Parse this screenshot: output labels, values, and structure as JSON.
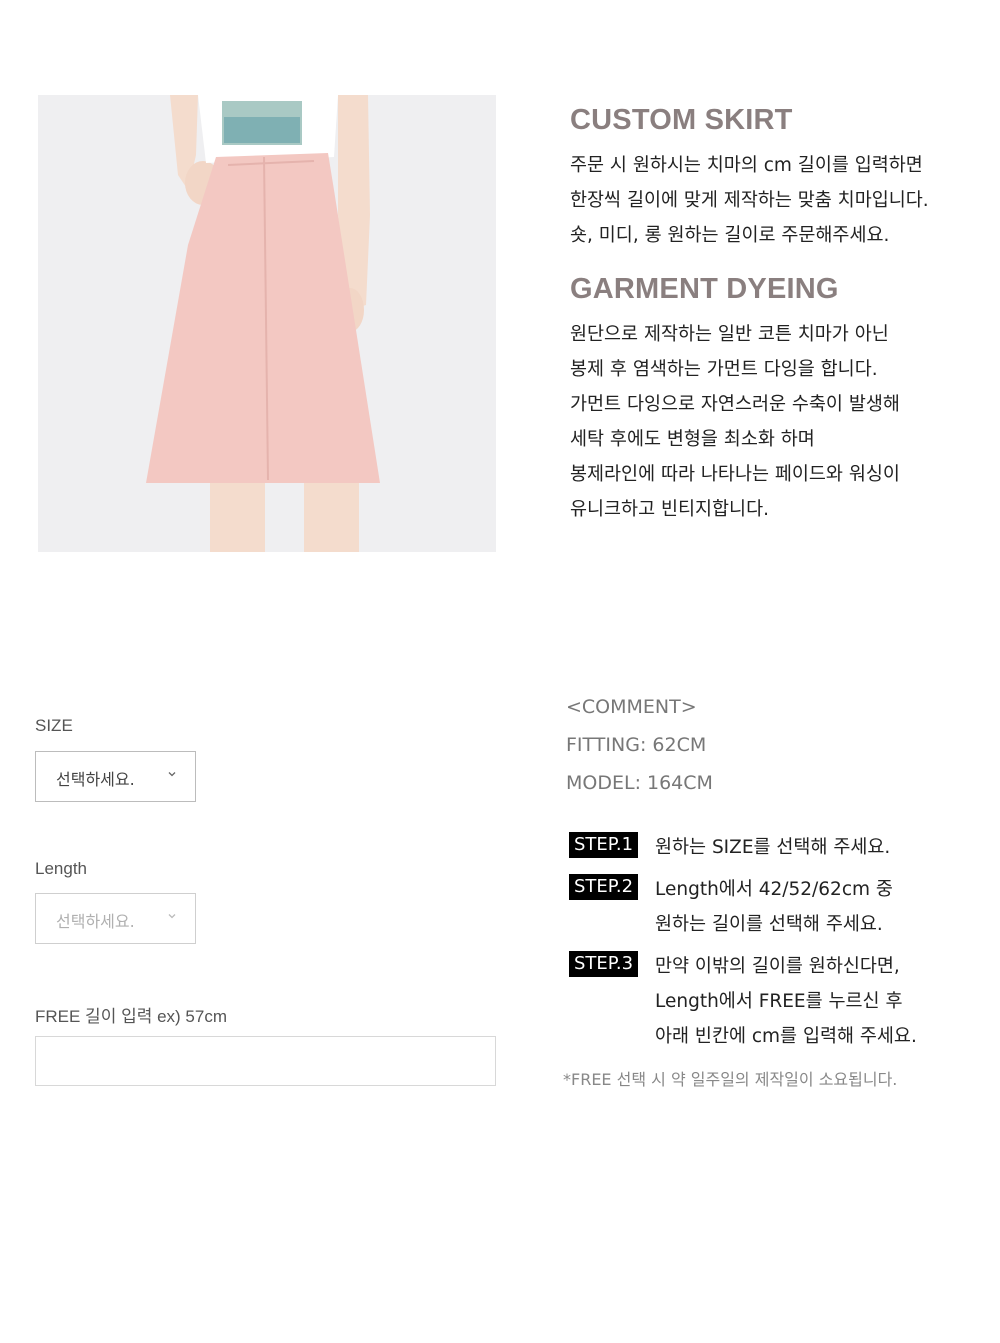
{
  "product": {
    "section1": {
      "title": "CUSTOM SKIRT",
      "lines": [
        "주문 시 원하시는 치마의 cm 길이를 입력하면",
        "한장씩 길이에 맞게 제작하는 맞춤 치마입니다.",
        "숏, 미디, 롱 원하는 길이로 주문해주세요."
      ]
    },
    "section2": {
      "title": "GARMENT DYEING",
      "lines": [
        "원단으로 제작하는 일반 코튼 치마가 아닌",
        "봉제 후 염색하는 가먼트 다잉을 합니다.",
        "가먼트 다잉으로 자연스러운 수축이 발생해",
        "세탁 후에도 변형을 최소화 하며",
        "봉제라인에 따라 나타나는 페이드와 워싱이",
        "유니크하고 빈티지합니다."
      ]
    }
  },
  "options": {
    "size": {
      "label": "SIZE",
      "value": "선택하세요."
    },
    "length": {
      "label": "Length",
      "value": "선택하세요."
    },
    "free": {
      "label": "FREE 길이 입력 ex) 57cm",
      "value": ""
    }
  },
  "comment": {
    "header": "<COMMENT>",
    "fitting": "FITTING: 62CM",
    "model": "MODEL: 164CM"
  },
  "steps": [
    {
      "badge": "STEP.1",
      "lines": [
        "원하는 SIZE를 선택해 주세요."
      ]
    },
    {
      "badge": "STEP.2",
      "lines": [
        "Length에서 42/52/62cm 중",
        "원하는 길이를 선택해 주세요."
      ]
    },
    {
      "badge": "STEP.3",
      "lines": [
        "만약 이밖의 길이를 원하신다면,",
        "Length에서 FREE를 누르신 후",
        "아래 빈칸에 cm를 입력해 주세요."
      ]
    }
  ],
  "note": "*FREE 선택 시 약 일주일의 제작일이 소요됩니다.",
  "colors": {
    "heading": "#8a7f7f",
    "skirt": "#f3c8c2",
    "badge_bg": "#000000"
  }
}
